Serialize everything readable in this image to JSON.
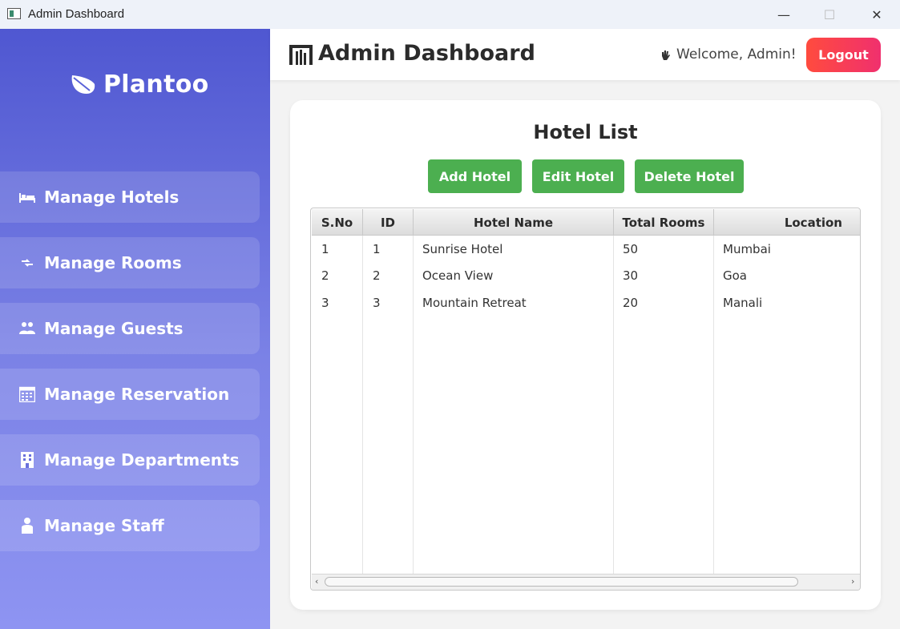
{
  "window": {
    "title": "Admin Dashboard",
    "minimize": "—",
    "maximize": "☐",
    "close": "✕"
  },
  "sidebar": {
    "brand": "Plantoo",
    "items": [
      {
        "label": "Manage Hotels",
        "icon": "bed-icon"
      },
      {
        "label": "Manage Rooms",
        "icon": "rooms-icon"
      },
      {
        "label": "Manage Guests",
        "icon": "guests-icon"
      },
      {
        "label": "Manage Reservation",
        "icon": "calendar-icon"
      },
      {
        "label": "Manage Departments",
        "icon": "building-icon"
      },
      {
        "label": "Manage Staff",
        "icon": "staff-icon"
      }
    ]
  },
  "header": {
    "title": "Admin Dashboard",
    "welcome": "Welcome, Admin!",
    "logout": "Logout"
  },
  "main": {
    "title": "Hotel List",
    "buttons": {
      "add": "Add Hotel",
      "edit": "Edit Hotel",
      "delete": "Delete Hotel"
    },
    "table": {
      "columns": [
        "S.No",
        "ID",
        "Hotel Name",
        "Total Rooms",
        "Location"
      ],
      "rows": [
        [
          "1",
          "1",
          "Sunrise Hotel",
          "50",
          "Mumbai"
        ],
        [
          "2",
          "2",
          "Ocean View",
          "30",
          "Goa"
        ],
        [
          "3",
          "3",
          "Mountain Retreat",
          "20",
          "Manali"
        ]
      ]
    }
  },
  "colors": {
    "sidebar_top": "#4f57d1",
    "sidebar_bottom": "#8e94f2",
    "action_button": "#4caf50",
    "logout_start": "#ff4b3e",
    "logout_end": "#f0306e"
  }
}
